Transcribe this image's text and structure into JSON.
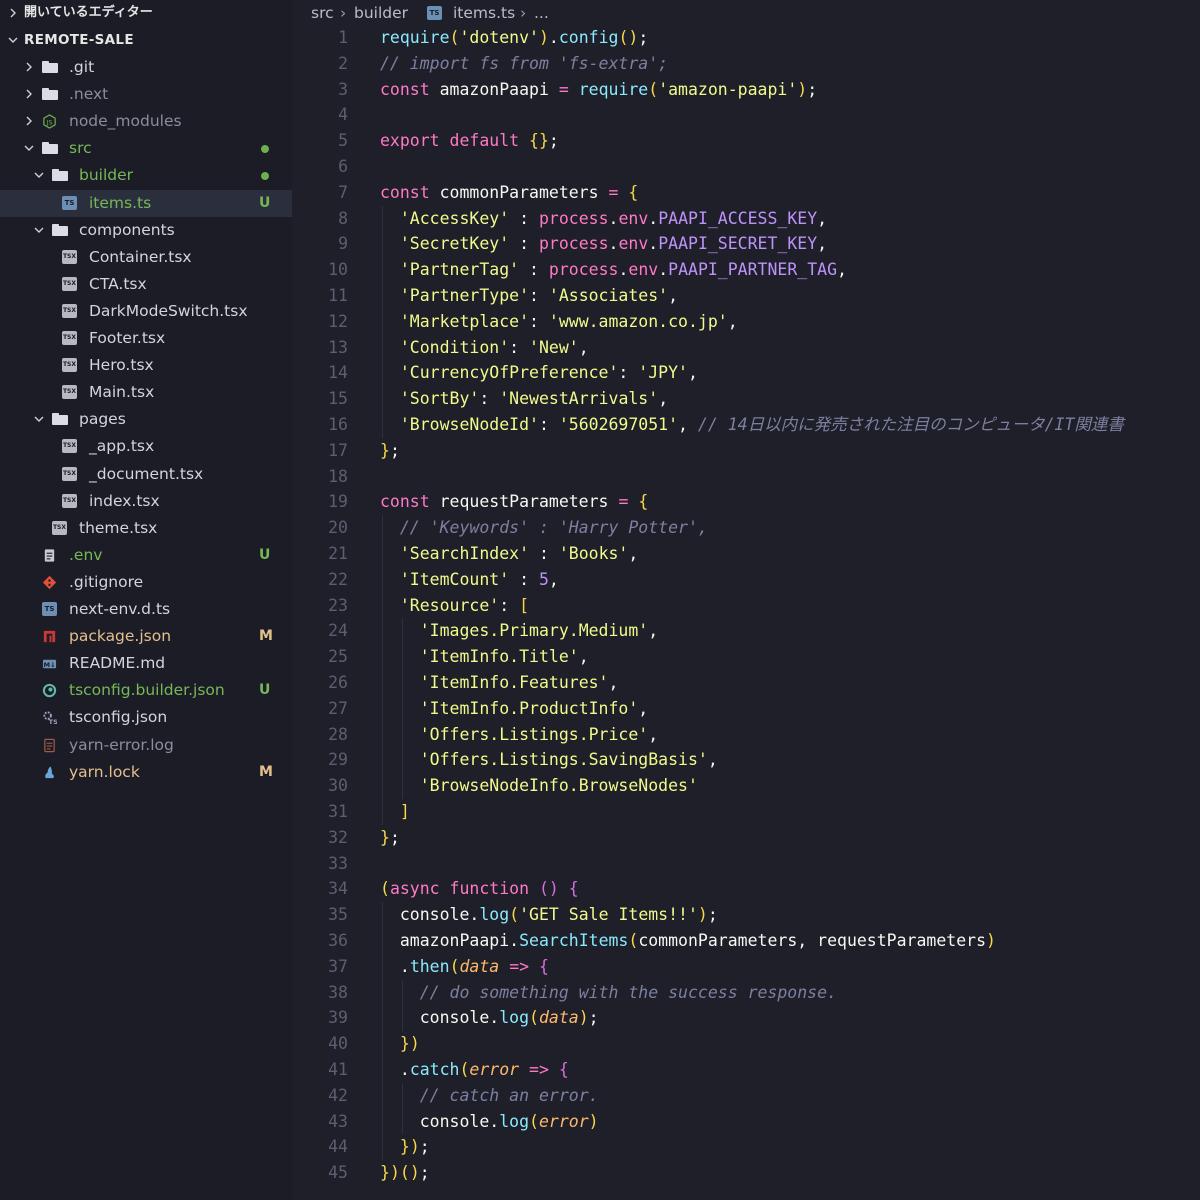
{
  "sidebar": {
    "open_editors_label": "開いているエディター",
    "workspace_label": "REMOTE-SALE",
    "items": [
      {
        "label": ".git",
        "depth": 1,
        "kind": "folder",
        "collapsed": true,
        "badge": "",
        "color": "#d4d4dc"
      },
      {
        "label": ".next",
        "depth": 1,
        "kind": "folder",
        "collapsed": true,
        "badge": "",
        "color": "#8a8d9c"
      },
      {
        "label": "node_modules",
        "depth": 1,
        "kind": "node-folder",
        "collapsed": true,
        "badge": "",
        "color": "#8a8d9c"
      },
      {
        "label": "src",
        "depth": 1,
        "kind": "folder",
        "collapsed": false,
        "badge": "dot",
        "color": "#76b858"
      },
      {
        "label": "builder",
        "depth": 2,
        "kind": "folder",
        "collapsed": false,
        "badge": "dot",
        "color": "#76b858"
      },
      {
        "label": "items.ts",
        "depth": 3,
        "kind": "ts",
        "badge": "U",
        "color": "#76b858",
        "selected": true
      },
      {
        "label": "components",
        "depth": 2,
        "kind": "folder",
        "collapsed": false,
        "badge": "",
        "color": "#d4d4dc"
      },
      {
        "label": "Container.tsx",
        "depth": 3,
        "kind": "tsx",
        "badge": "",
        "color": "#d4d4dc"
      },
      {
        "label": "CTA.tsx",
        "depth": 3,
        "kind": "tsx",
        "badge": "",
        "color": "#d4d4dc"
      },
      {
        "label": "DarkModeSwitch.tsx",
        "depth": 3,
        "kind": "tsx",
        "badge": "",
        "color": "#d4d4dc"
      },
      {
        "label": "Footer.tsx",
        "depth": 3,
        "kind": "tsx",
        "badge": "",
        "color": "#d4d4dc"
      },
      {
        "label": "Hero.tsx",
        "depth": 3,
        "kind": "tsx",
        "badge": "",
        "color": "#d4d4dc"
      },
      {
        "label": "Main.tsx",
        "depth": 3,
        "kind": "tsx",
        "badge": "",
        "color": "#d4d4dc"
      },
      {
        "label": "pages",
        "depth": 2,
        "kind": "folder",
        "collapsed": false,
        "badge": "",
        "color": "#d4d4dc"
      },
      {
        "label": "_app.tsx",
        "depth": 3,
        "kind": "tsx",
        "badge": "",
        "color": "#d4d4dc"
      },
      {
        "label": "_document.tsx",
        "depth": 3,
        "kind": "tsx",
        "badge": "",
        "color": "#d4d4dc"
      },
      {
        "label": "index.tsx",
        "depth": 3,
        "kind": "tsx",
        "badge": "",
        "color": "#d4d4dc"
      },
      {
        "label": "theme.tsx",
        "depth": 2,
        "kind": "tsx",
        "badge": "",
        "color": "#d4d4dc"
      },
      {
        "label": ".env",
        "depth": 1,
        "kind": "file",
        "badge": "U",
        "color": "#76b858"
      },
      {
        "label": ".gitignore",
        "depth": 1,
        "kind": "git",
        "badge": "",
        "color": "#d4d4dc"
      },
      {
        "label": "next-env.d.ts",
        "depth": 1,
        "kind": "ts",
        "badge": "",
        "color": "#d4d4dc"
      },
      {
        "label": "package.json",
        "depth": 1,
        "kind": "npm",
        "badge": "M",
        "color": "#e2c08d"
      },
      {
        "label": "README.md",
        "depth": 1,
        "kind": "md",
        "badge": "",
        "color": "#d4d4dc"
      },
      {
        "label": "tsconfig.builder.json",
        "depth": 1,
        "kind": "tsconfig",
        "badge": "U",
        "color": "#76b858"
      },
      {
        "label": "tsconfig.json",
        "depth": 1,
        "kind": "tsgear",
        "badge": "",
        "color": "#d4d4dc"
      },
      {
        "label": "yarn-error.log",
        "depth": 1,
        "kind": "log",
        "badge": "",
        "color": "#8a8d9c"
      },
      {
        "label": "yarn.lock",
        "depth": 1,
        "kind": "yarn",
        "badge": "M",
        "color": "#e2c08d"
      }
    ]
  },
  "breadcrumb": {
    "parts": [
      "src",
      "builder",
      "items.ts",
      "..."
    ]
  },
  "editor": {
    "start_line": 1,
    "lines": [
      "require('dotenv').config();",
      "// import fs from 'fs-extra';",
      "const amazonPaapi = require('amazon-paapi');",
      "",
      "export default {};",
      "",
      "const commonParameters = {",
      "  'AccessKey' : process.env.PAAPI_ACCESS_KEY,",
      "  'SecretKey' : process.env.PAAPI_SECRET_KEY,",
      "  'PartnerTag' : process.env.PAAPI_PARTNER_TAG,",
      "  'PartnerType': 'Associates',",
      "  'Marketplace': 'www.amazon.co.jp',",
      "  'Condition': 'New',",
      "  'CurrencyOfPreference': 'JPY',",
      "  'SortBy': 'NewestArrivals',",
      "  'BrowseNodeId': '5602697051', // 14日以内に発売された注目のコンピュータ/IT関連書",
      "};",
      "",
      "const requestParameters = {",
      "  // 'Keywords' : 'Harry Potter',",
      "  'SearchIndex' : 'Books',",
      "  'ItemCount' : 5,",
      "  'Resource': [",
      "    'Images.Primary.Medium',",
      "    'ItemInfo.Title',",
      "    'ItemInfo.Features',",
      "    'ItemInfo.ProductInfo',",
      "    'Offers.Listings.Price',",
      "    'Offers.Listings.SavingBasis',",
      "    'BrowseNodeInfo.BrowseNodes'",
      "  ]",
      "};",
      "",
      "(async function () {",
      "  console.log('GET Sale Items!!');",
      "  amazonPaapi.SearchItems(commonParameters, requestParameters)",
      "  .then(data => {",
      "    // do something with the success response.",
      "    console.log(data);",
      "  })",
      "  .catch(error => {",
      "    // catch an error.",
      "    console.log(error)",
      "  });",
      "})();"
    ]
  }
}
